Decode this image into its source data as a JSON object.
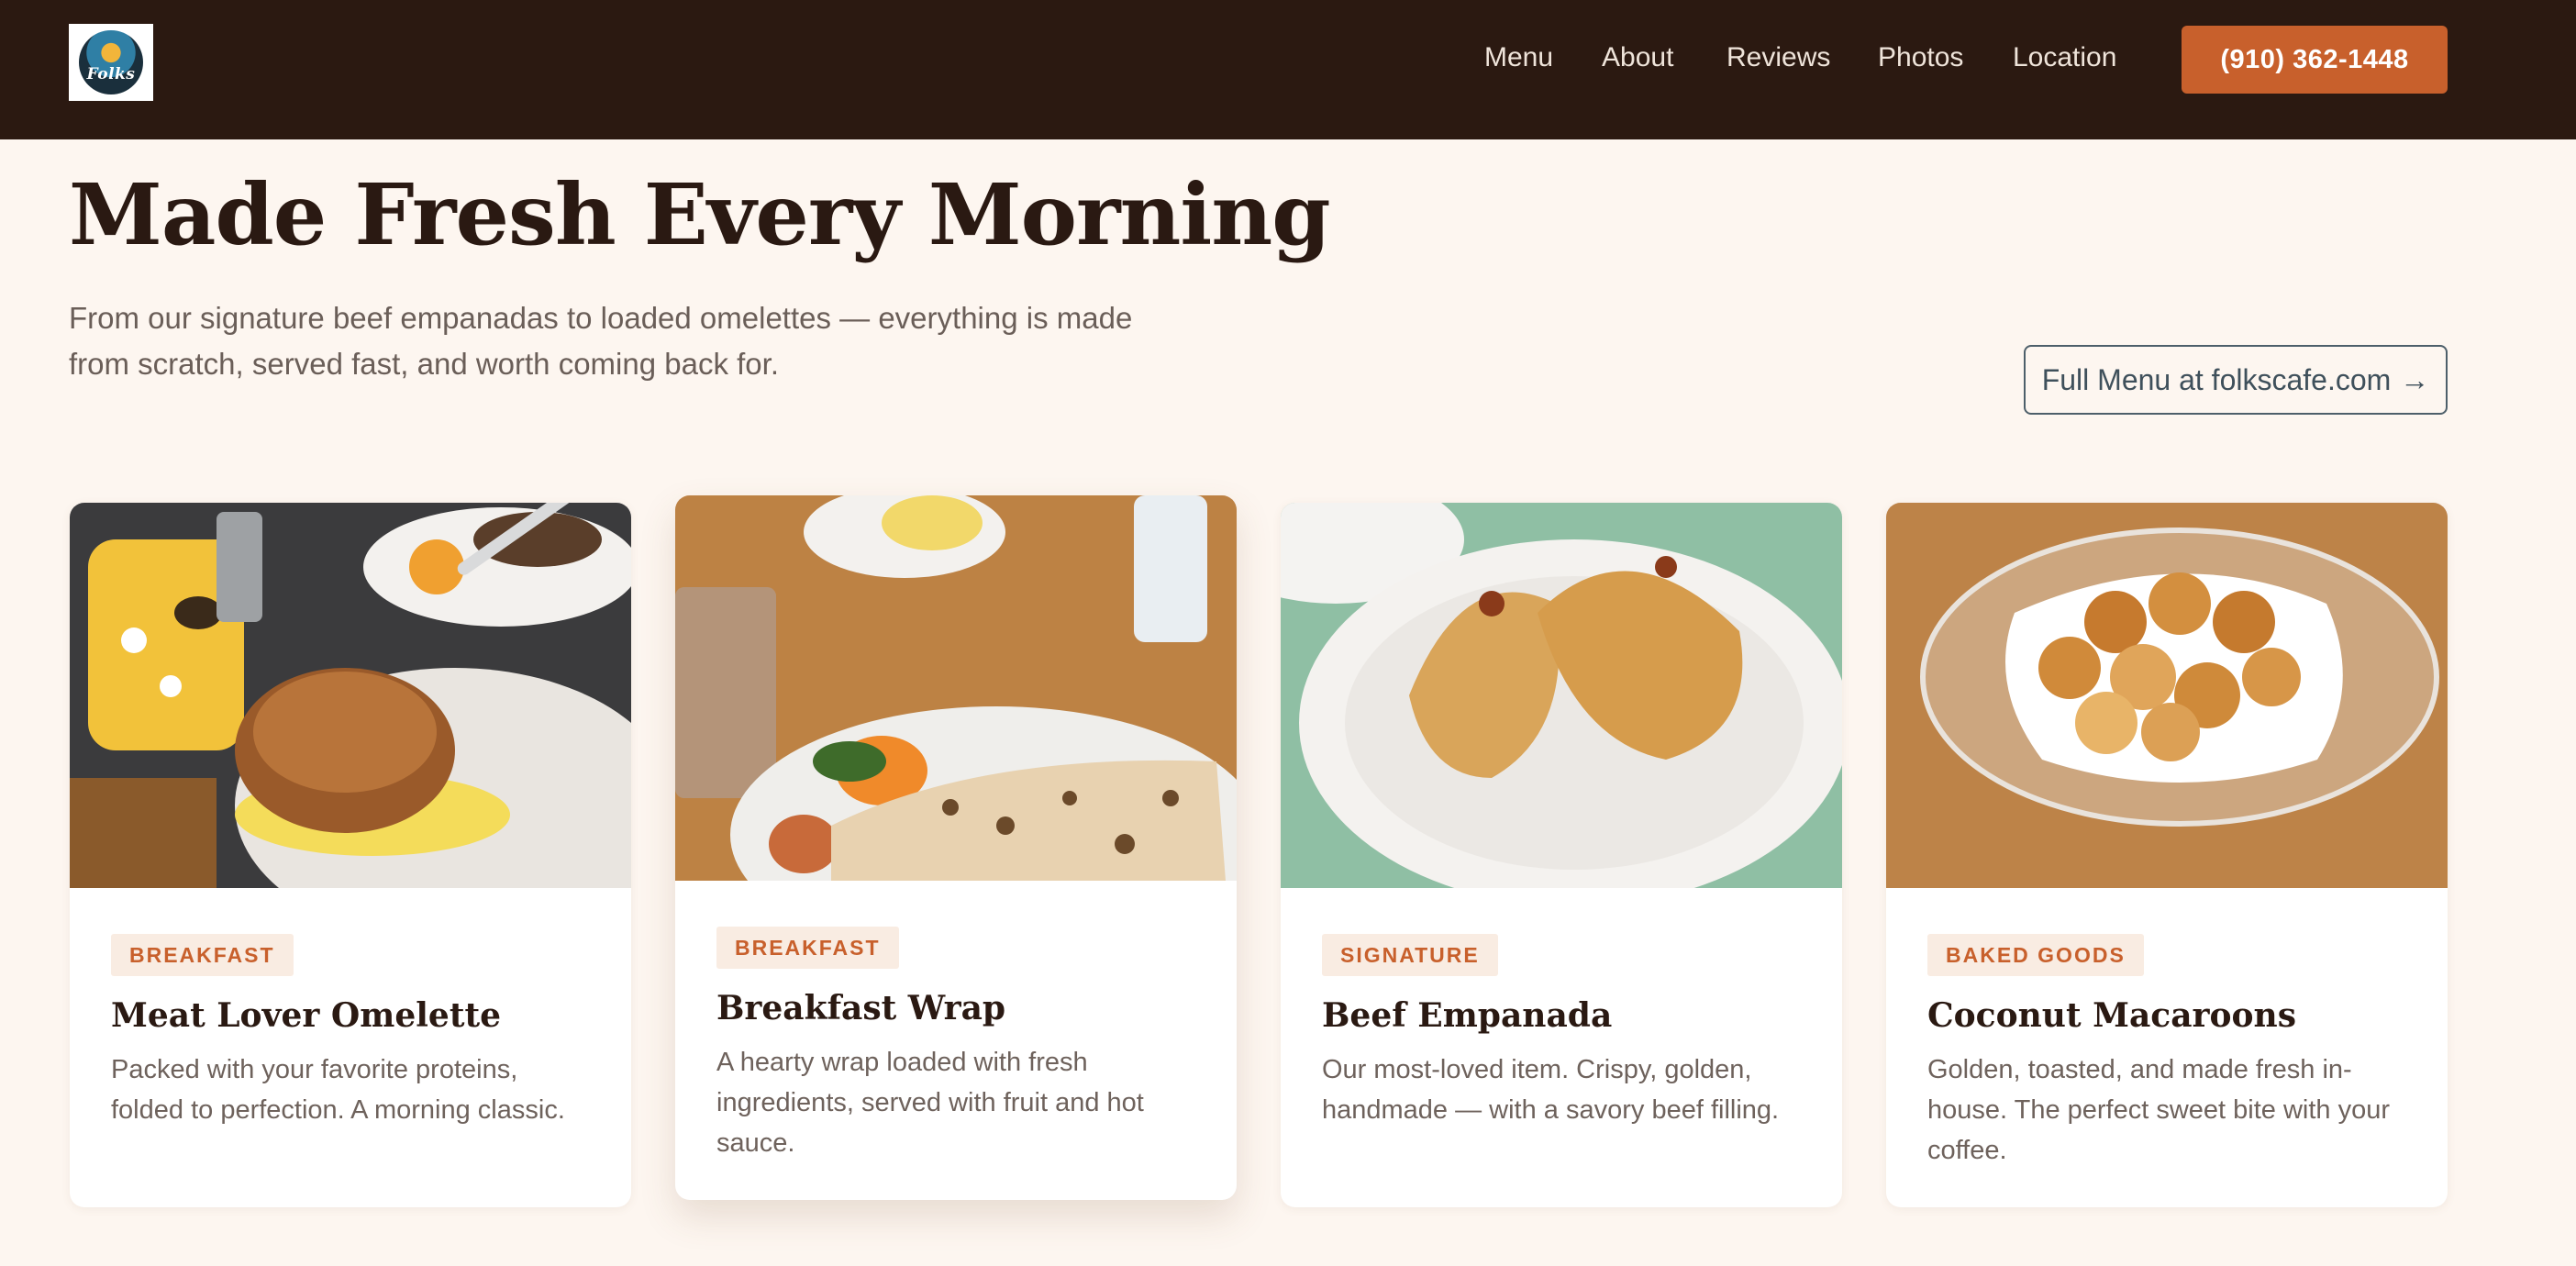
{
  "header": {
    "logo_text": "Folks",
    "nav": [
      {
        "label": "Menu"
      },
      {
        "label": "About"
      },
      {
        "label": "Reviews"
      },
      {
        "label": "Photos"
      },
      {
        "label": "Location"
      }
    ],
    "phone_label": "(910) 362-1448"
  },
  "hero": {
    "title": "Made Fresh Every Morning",
    "subtitle": "From our signature beef empanadas to loaded omelettes — everything is made from scratch, served fast, and worth coming back for.",
    "full_menu_label": "Full Menu at folkscafe.com",
    "full_menu_arrow": "→"
  },
  "cards": [
    {
      "tag": "BREAKFAST",
      "title": "Meat Lover Omelette",
      "desc": "Packed with your favorite proteins, folded to perfection. A morning classic.",
      "image_icon": "sandwich-photo"
    },
    {
      "tag": "BREAKFAST",
      "title": "Breakfast Wrap",
      "desc": "A hearty wrap loaded with fresh ingredients, served with fruit and hot sauce.",
      "image_icon": "wrap-photo"
    },
    {
      "tag": "SIGNATURE",
      "title": "Beef Empanada",
      "desc": "Our most-loved item. Crispy, golden, handmade — with a savory beef filling.",
      "image_icon": "empanada-photo"
    },
    {
      "tag": "BAKED GOODS",
      "title": "Coconut Macaroons",
      "desc": "Golden, toasted, and made fresh in-house. The perfect sweet bite with your coffee.",
      "image_icon": "macaroon-photo"
    }
  ],
  "colors": {
    "header_bg": "#2b1911",
    "accent": "#c8602c",
    "page_bg": "#fdf6f0",
    "text_dark": "#2a1912"
  }
}
